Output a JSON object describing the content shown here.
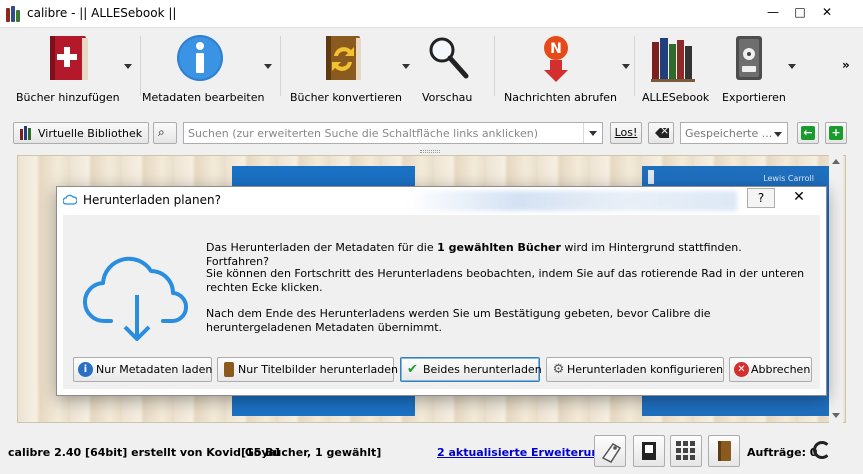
{
  "window": {
    "title": "calibre - || ALLESebook ||",
    "min_glyph": "—",
    "max_glyph": "□",
    "close_glyph": "✕"
  },
  "toolbar": {
    "items": [
      {
        "label": "Bücher hinzufügen",
        "icon": "add-book-icon"
      },
      {
        "label": "Metadaten bearbeiten",
        "icon": "info-icon"
      },
      {
        "label": "Bücher konvertieren",
        "icon": "convert-icon"
      },
      {
        "label": "Vorschau",
        "icon": "magnifier-icon"
      },
      {
        "label": "Nachrichten abrufen",
        "icon": "news-icon"
      },
      {
        "label": "ALLESebook",
        "icon": "library-icon"
      },
      {
        "label": "Exportieren",
        "icon": "device-icon"
      }
    ],
    "more": "»",
    "news_letter": "N"
  },
  "searchbar": {
    "virtual_library": "Virtuelle Bibliothek",
    "search_placeholder": "Suchen (zur erweiterten Suche die Schaltfläche links anklicken)",
    "search_go": "Los!",
    "saved_searches_placeholder": "Gespeicherte ...",
    "binoculars": "⌕"
  },
  "bookarea": {
    "author_on_cover": "Lewis Carroll"
  },
  "dialog": {
    "title": "Herunterladen planen?",
    "help": "?",
    "close": "✕",
    "msg1_pre": "Das Herunterladen der Metadaten für die ",
    "msg1_bold": "1 gewählten Bücher",
    "msg1_post": " wird im Hintergrund stattfinden. Fortfahren?",
    "msg2": "Sie können den Fortschritt des Herunterladens beobachten, indem Sie auf das rotierende Rad in der unteren rechten Ecke klicken.",
    "msg3": "Nach dem Ende des Herunterladens werden Sie um Bestätigung gebeten, bevor Calibre die heruntergeladenen Metadaten übernimmt.",
    "buttons": {
      "metadata_only": "Nur Metadaten laden",
      "covers_only": "Nur Titelbilder herunterladen",
      "both": "Beides herunterladen",
      "configure": "Herunterladen konfigurieren",
      "cancel": "Abbrechen"
    }
  },
  "statusbar": {
    "version": "calibre 2.40 [64bit] erstellt von Kovid Goyal",
    "count": "[15 Bücher, 1 gewählt]",
    "updates_link": "2 aktualisierte Erweiterungen",
    "jobs": "Aufträge: 0"
  },
  "colors": {
    "accent_blue": "#1b71c4",
    "cloud_blue": "#2a8ee0",
    "link": "#0000cc"
  }
}
